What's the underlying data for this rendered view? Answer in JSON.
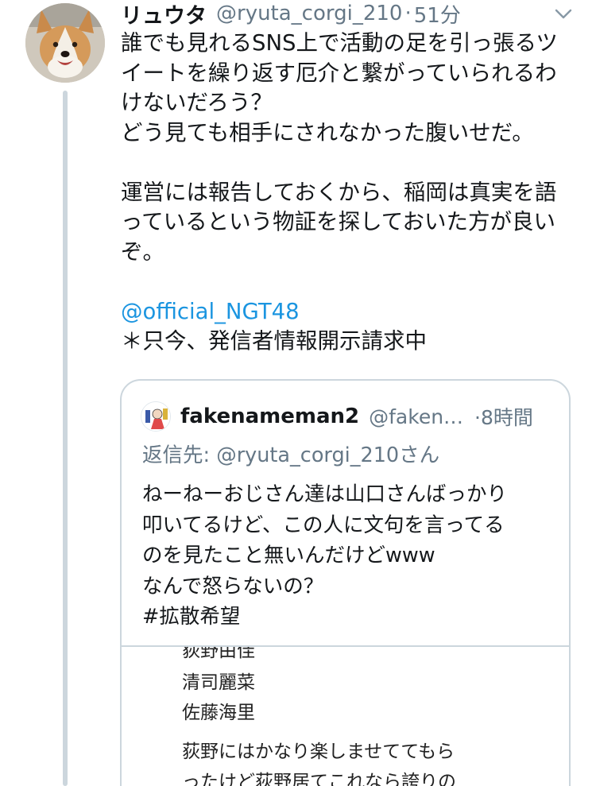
{
  "tweet": {
    "display_name": "リュウタ",
    "handle": "@ryuta_corgi_210",
    "separator": "·",
    "time": "51分",
    "lines": [
      "誰でも見れるSNS上で活動の足を引っ張るツ",
      "イートを繰り返す厄介と繋がっていられるわ",
      "けないだろう？",
      "どう見ても相手にされなかった腹いせだ。",
      "",
      "運営には報告しておくから、稲岡は真実を語",
      "っているという物証を探しておいた方が良い",
      "ぞ。",
      ""
    ],
    "mention": "@official_NGT48",
    "last_line": "＊只今、発信者情報開示請求中"
  },
  "quote": {
    "display_name": "fakenameman2",
    "handle": "@faken…",
    "time": "·8時間",
    "reply_to": "返信先: @ryuta_corgi_210さん",
    "lines": [
      "ねーねーおじさん達は山口さんばっかり",
      "叩いてるけど、この人に文句を言ってる",
      "のを見たこと無いんだけどwww",
      "なんで怒らないの？",
      "#拡散希望"
    ],
    "media_lines": [
      "荻野由佳",
      "清司麗菜",
      "佐藤海里",
      "荻野にはかなり楽しませててもら",
      "ったけど荻野居てこれなら誇りの"
    ]
  },
  "icons": {
    "avatar": "corgi-avatar",
    "chevron": "chevron-down-icon",
    "quote_avatar": "user-avatar"
  },
  "colors": {
    "mention": "#1b95e0",
    "secondary_text": "#657786",
    "border": "#ccd6dd"
  }
}
